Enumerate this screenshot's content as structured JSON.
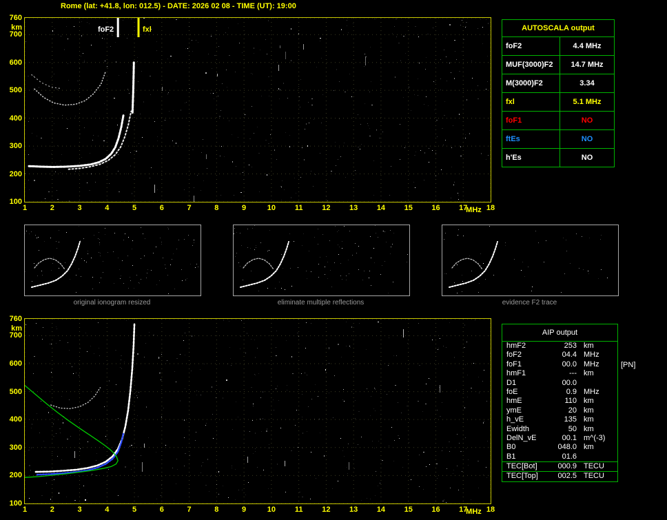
{
  "header": {
    "title": "Rome (lat: +41.8, lon: 012.5) - DATE: 2026 02 08 - TIME (UT): 19:00"
  },
  "colors": {
    "axis_yellow": "#ffff00",
    "plot_border": "#c8c800",
    "table_border": "#00b400",
    "trace_white": "#ffffff",
    "profile_green": "#00cc00",
    "restored_blue": "#2b4bff",
    "red": "#ff0000",
    "blue": "#1e90ff"
  },
  "top_plot": {
    "name": "ionogram-top",
    "x_min": 1,
    "x_max": 18,
    "x_ticks": [
      1,
      2,
      3,
      4,
      5,
      6,
      7,
      8,
      9,
      10,
      11,
      12,
      13,
      14,
      15,
      16,
      17,
      18
    ],
    "x_unit": "MHz",
    "y_min": 100,
    "y_max": 760,
    "y_ticks": [
      760,
      700,
      600,
      500,
      400,
      300,
      200,
      100
    ],
    "y_unit": "km",
    "markers": [
      {
        "label": "foF2",
        "freq": 4.4,
        "color": "#ffffff",
        "side": "left"
      },
      {
        "label": "fxl",
        "freq": 5.15,
        "color": "#ffff00",
        "side": "right"
      }
    ],
    "traces": [
      {
        "name": "F2-trace-ordinary",
        "color": "#ffffff",
        "width": 3,
        "dash": "3 2",
        "points": [
          [
            1.15,
            228
          ],
          [
            1.6,
            226
          ],
          [
            2.0,
            225
          ],
          [
            2.5,
            226
          ],
          [
            3.0,
            229
          ],
          [
            3.4,
            234
          ],
          [
            3.7,
            242
          ],
          [
            3.95,
            254
          ],
          [
            4.15,
            272
          ],
          [
            4.3,
            295
          ],
          [
            4.42,
            328
          ],
          [
            4.52,
            368
          ],
          [
            4.6,
            412
          ]
        ]
      },
      {
        "name": "F2-trace-extraordinary",
        "color": "#e8e8e8",
        "width": 2,
        "dash": "2 3",
        "points": [
          [
            2.6,
            217
          ],
          [
            3.0,
            220
          ],
          [
            3.4,
            226
          ],
          [
            3.75,
            235
          ],
          [
            4.05,
            249
          ],
          [
            4.3,
            269
          ],
          [
            4.5,
            297
          ],
          [
            4.65,
            333
          ],
          [
            4.78,
            377
          ],
          [
            4.88,
            425
          ]
        ]
      },
      {
        "name": "F2-asymptote",
        "color": "#ffffff",
        "width": 3,
        "dash": "5 2",
        "points": [
          [
            4.93,
            420
          ],
          [
            4.96,
            510
          ],
          [
            4.98,
            600
          ]
        ]
      },
      {
        "name": "second-hop-trace",
        "color": "#d0d0d0",
        "width": 1.5,
        "dash": "1 3",
        "points": [
          [
            1.35,
            505
          ],
          [
            1.7,
            474
          ],
          [
            2.05,
            455
          ],
          [
            2.45,
            447
          ],
          [
            2.85,
            450
          ],
          [
            3.2,
            463
          ],
          [
            3.5,
            487
          ],
          [
            3.78,
            522
          ],
          [
            3.95,
            568
          ]
        ]
      },
      {
        "name": "second-hop-trace-2",
        "color": "#b0b0b0",
        "width": 1.2,
        "dash": "1 4",
        "points": [
          [
            1.25,
            556
          ],
          [
            1.6,
            528
          ],
          [
            1.95,
            512
          ],
          [
            2.35,
            506
          ]
        ]
      }
    ]
  },
  "autoscala_table": {
    "title": "AUTOSCALA output",
    "rows": [
      {
        "param": "foF2",
        "value": "4.4 MHz",
        "color": "#ffffff"
      },
      {
        "param": "MUF(3000)F2",
        "value": "14.7 MHz",
        "color": "#ffffff"
      },
      {
        "param": "M(3000)F2",
        "value": "3.34",
        "color": "#ffffff"
      },
      {
        "param": "fxl",
        "value": "5.1 MHz",
        "color": "#ffff00"
      },
      {
        "param": "foF1",
        "value": "NO",
        "color": "#ff0000"
      },
      {
        "param": "ftEs",
        "value": "NO",
        "color": "#1e90ff"
      },
      {
        "param": "h'Es",
        "value": "NO",
        "color": "#ffffff"
      }
    ]
  },
  "thumbnails": [
    {
      "caption": "original ionogram resized"
    },
    {
      "caption": "eliminate multiple reflections"
    },
    {
      "caption": "evidence F2 trace"
    }
  ],
  "thumb_traces": [
    {
      "points": [
        [
          10,
          90
        ],
        [
          22,
          87
        ],
        [
          34,
          84
        ],
        [
          45,
          80
        ],
        [
          54,
          74
        ],
        [
          62,
          66
        ],
        [
          68,
          56
        ],
        [
          73,
          45
        ],
        [
          77,
          34
        ],
        [
          80,
          24
        ]
      ]
    },
    {
      "points": [
        [
          14,
          62
        ],
        [
          20,
          55
        ],
        [
          28,
          50
        ],
        [
          36,
          48
        ],
        [
          44,
          50
        ],
        [
          52,
          56
        ],
        [
          58,
          64
        ]
      ]
    }
  ],
  "bottom_plot": {
    "name": "profilogram-bottom",
    "x_min": 1,
    "x_max": 18,
    "x_ticks": [
      1,
      2,
      3,
      4,
      5,
      6,
      7,
      8,
      9,
      10,
      11,
      12,
      13,
      14,
      15,
      16,
      17,
      18
    ],
    "x_unit": "MHz",
    "y_min": 100,
    "y_max": 760,
    "y_ticks": [
      760,
      700,
      600,
      500,
      400,
      300,
      200,
      100
    ],
    "y_unit": "km",
    "markers": [],
    "traces": [
      {
        "name": "F2-trace",
        "color": "#ffffff",
        "width": 2.6,
        "dash": "3 2",
        "points": [
          [
            1.4,
            213
          ],
          [
            1.9,
            214
          ],
          [
            2.4,
            217
          ],
          [
            2.9,
            221
          ],
          [
            3.3,
            227
          ],
          [
            3.65,
            236
          ],
          [
            3.95,
            249
          ],
          [
            4.2,
            268
          ],
          [
            4.4,
            295
          ],
          [
            4.55,
            330
          ],
          [
            4.67,
            375
          ],
          [
            4.77,
            432
          ],
          [
            4.85,
            500
          ],
          [
            4.92,
            580
          ],
          [
            4.97,
            665
          ],
          [
            5.0,
            745
          ]
        ]
      },
      {
        "name": "restored-trace-blue",
        "color": "#2b4bff",
        "width": 2.4,
        "dash": "2 2",
        "points": [
          [
            1.45,
            203
          ],
          [
            1.9,
            205
          ],
          [
            2.4,
            208
          ],
          [
            2.9,
            213
          ],
          [
            3.3,
            219
          ],
          [
            3.65,
            228
          ],
          [
            3.95,
            241
          ],
          [
            4.2,
            259
          ],
          [
            4.4,
            285
          ],
          [
            4.52,
            318
          ],
          [
            4.6,
            352
          ]
        ]
      },
      {
        "name": "second-hop-trace",
        "color": "#c8c8c8",
        "width": 1.4,
        "dash": "1 3",
        "points": [
          [
            1.95,
            452
          ],
          [
            2.3,
            441
          ],
          [
            2.65,
            439
          ],
          [
            3.0,
            446
          ],
          [
            3.3,
            461
          ],
          [
            3.55,
            484
          ],
          [
            3.75,
            514
          ]
        ]
      },
      {
        "name": "electron-density-profile",
        "color": "#00cc00",
        "width": 1.3,
        "dash": "",
        "points": [
          [
            1.0,
            522
          ],
          [
            1.4,
            489
          ],
          [
            1.8,
            456
          ],
          [
            2.2,
            425
          ],
          [
            2.6,
            396
          ],
          [
            3.0,
            369
          ],
          [
            3.35,
            346
          ],
          [
            3.65,
            326
          ],
          [
            3.9,
            309
          ],
          [
            4.1,
            294
          ],
          [
            4.25,
            280
          ],
          [
            4.35,
            267
          ],
          [
            4.4,
            253
          ],
          [
            4.33,
            241
          ],
          [
            4.15,
            232
          ],
          [
            3.85,
            225
          ],
          [
            3.45,
            218
          ],
          [
            3.0,
            212
          ],
          [
            2.5,
            206
          ],
          [
            2.0,
            201
          ],
          [
            1.5,
            196
          ],
          [
            1.0,
            193
          ]
        ]
      }
    ]
  },
  "aip_table": {
    "title": "AIP output",
    "pn_flag": "[PN]",
    "rows": [
      {
        "param": "hmF2",
        "value": "253",
        "unit": "km"
      },
      {
        "param": "foF2",
        "value": "04.4",
        "unit": "MHz"
      },
      {
        "param": "foF1",
        "value": "00.0",
        "unit": "MHz"
      },
      {
        "param": "hmF1",
        "value": "---",
        "unit": "km"
      },
      {
        "param": "D1",
        "value": "00.0",
        "unit": ""
      },
      {
        "param": "foE",
        "value": "0.9",
        "unit": "MHz"
      },
      {
        "param": "hmE",
        "value": "110",
        "unit": "km"
      },
      {
        "param": "ymE",
        "value": "20",
        "unit": "km"
      },
      {
        "param": "h_vE",
        "value": "135",
        "unit": "km"
      },
      {
        "param": "Ewidth",
        "value": "50",
        "unit": "km"
      },
      {
        "param": "DelN_vE",
        "value": "00.1",
        "unit": "m^(-3)"
      },
      {
        "param": "B0",
        "value": "048.0",
        "unit": "km"
      },
      {
        "param": "B1",
        "value": "01.6",
        "unit": ""
      },
      {
        "param": "TEC[Bot]",
        "value": "000.9",
        "unit": "TECU",
        "rule_above": true
      },
      {
        "param": "TEC[Top]",
        "value": "002.5",
        "unit": "TECU",
        "rule_above": true
      }
    ]
  }
}
